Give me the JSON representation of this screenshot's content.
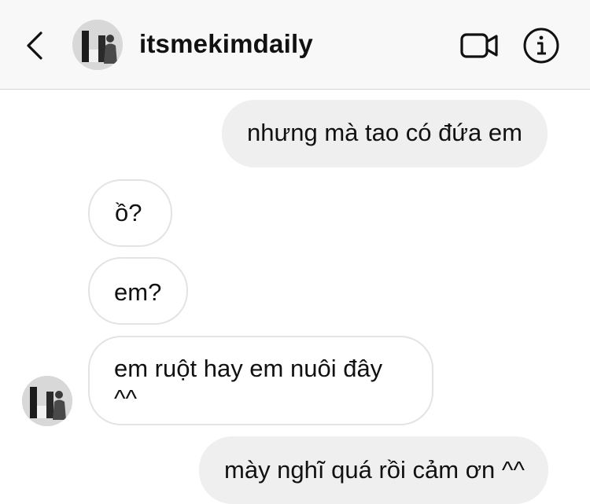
{
  "header": {
    "username": "itsmekimdaily",
    "icons": {
      "back": "chevron-left-icon",
      "video": "video-camera-icon",
      "info": "info-icon"
    }
  },
  "messages": [
    {
      "side": "sent",
      "text": "nhưng mà tao có đứa em"
    },
    {
      "side": "received",
      "text": "ồ?"
    },
    {
      "side": "received",
      "text": "em?"
    },
    {
      "side": "received",
      "lines": [
        "em ruột hay em nuôi đây",
        "^^"
      ]
    },
    {
      "side": "sent",
      "text": "mày nghĩ quá rồi cảm ơn ^^"
    }
  ],
  "colors": {
    "header_bg": "#f8f8f8",
    "sent_bubble": "#efefef",
    "received_border": "#e3e3e3",
    "text": "#111111"
  }
}
